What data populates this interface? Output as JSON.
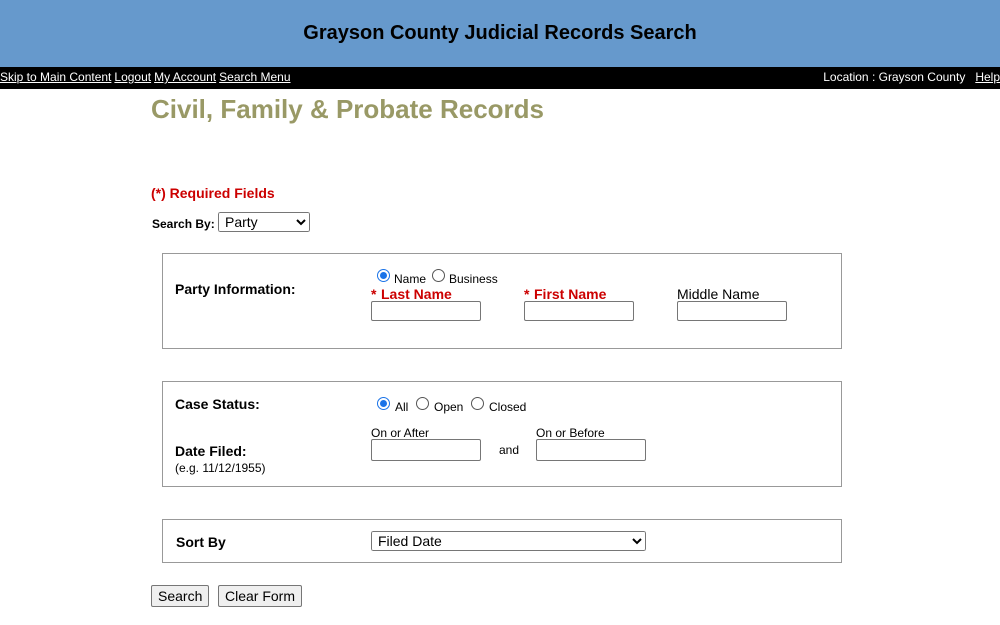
{
  "header": {
    "title": "Grayson County Judicial Records Search"
  },
  "nav": {
    "links": [
      "Skip to Main Content",
      "Logout",
      "My Account",
      "Search Menu"
    ],
    "location": "Location : Grayson County",
    "help": "Help"
  },
  "page": {
    "title": "Civil, Family & Probate Records",
    "required_note": "(*) Required Fields"
  },
  "search_by": {
    "label": "Search By:",
    "selected": "Party"
  },
  "party": {
    "label": "Party Information:",
    "type_options": [
      "Name",
      "Business"
    ],
    "type_selected": "Name",
    "last_name_label": "Last Name",
    "first_name_label": "First Name",
    "middle_name_label": "Middle Name",
    "required_mark": "*",
    "last_name_value": "",
    "first_name_value": "",
    "middle_name_value": ""
  },
  "case": {
    "status_label": "Case Status:",
    "status_options": [
      "All",
      "Open",
      "Closed"
    ],
    "status_selected": "All",
    "date_filed_label": "Date Filed:",
    "date_example": "(e.g. 11/12/1955)",
    "on_or_after_label": "On or After",
    "on_or_before_label": "On or Before",
    "and_label": "and",
    "on_or_after_value": "",
    "on_or_before_value": ""
  },
  "sort": {
    "label": "Sort By",
    "selected": "Filed Date"
  },
  "buttons": {
    "search": "Search",
    "clear": "Clear Form"
  },
  "colors": {
    "banner": "#6699cc",
    "title": "#999966",
    "required": "#cc0000",
    "radio_checked": "#1a73e8"
  }
}
